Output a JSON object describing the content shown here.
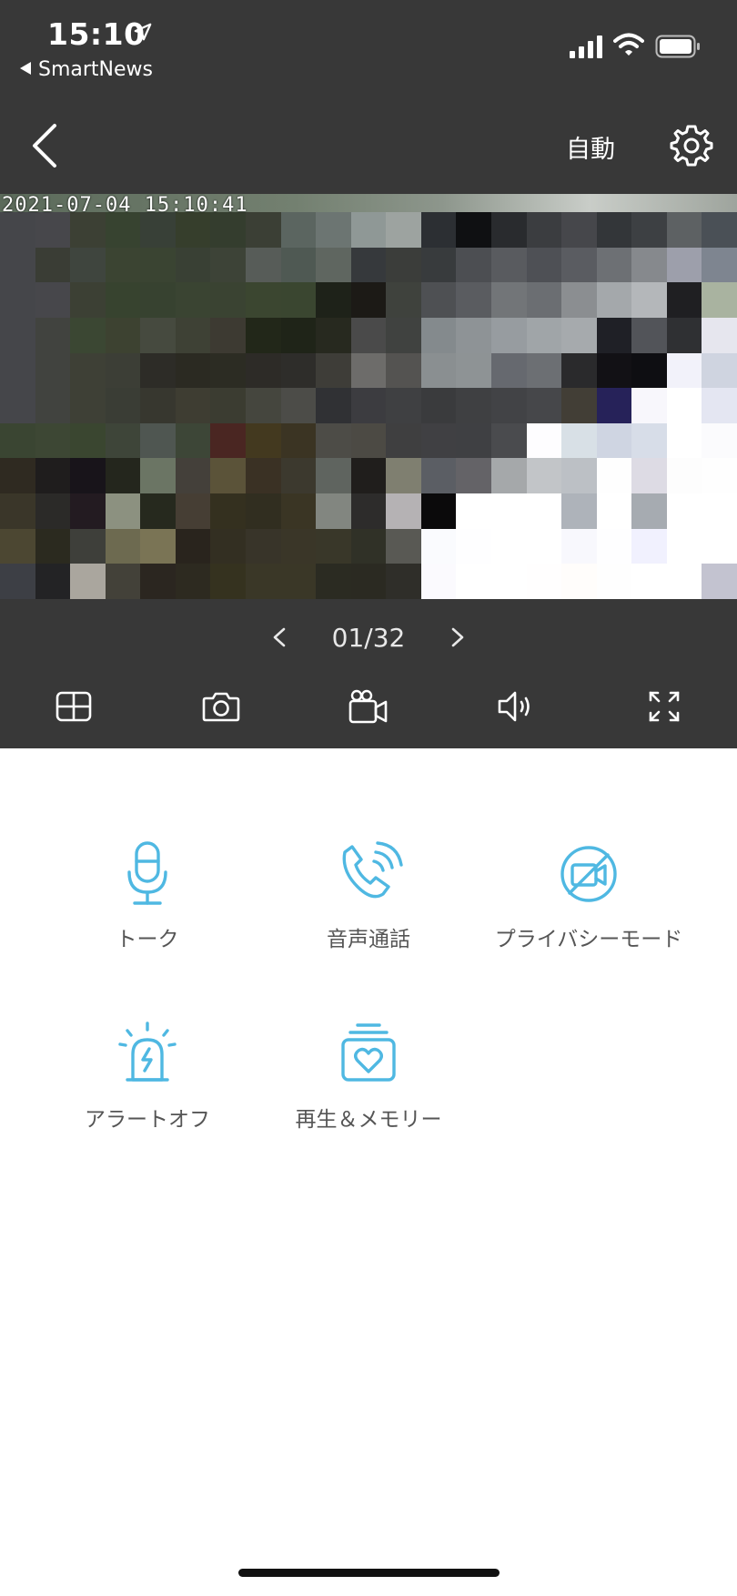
{
  "status_bar": {
    "time": "15:10",
    "back_app": "SmartNews",
    "icons": [
      "location-arrow-icon",
      "signal-icon",
      "wifi-icon",
      "battery-icon"
    ]
  },
  "nav": {
    "mode_label": "自動",
    "icons": [
      "back-chevron-icon",
      "gear-icon"
    ]
  },
  "video": {
    "timestamp": "2021-07-04  15:10:41",
    "mosaic_colors": [
      [
        "#45464a",
        "#47474b",
        "#3c4034",
        "#374330",
        "#384037",
        "#363e2c",
        "#343d2e",
        "#3b3f35",
        "#5b6560",
        "#6c7572",
        "#8f9896",
        "#9da3a0",
        "#2c2f33",
        "#0f1012",
        "#292b2e",
        "#3b3d40",
        "#46474b",
        "#333639",
        "#3d4043",
        "#5d6163",
        "#4a5056"
      ],
      [
        "#45464a",
        "#3a3d35",
        "#3f453e",
        "#3b4432",
        "#3a4432",
        "#394034",
        "#3d4337",
        "#575c58",
        "#4f5953",
        "#5f6660",
        "#36393c",
        "#3b3d3a",
        "#383b3d",
        "#4c4e52",
        "#595b5f",
        "#4e5055",
        "#5a5c61",
        "#6d7074",
        "#86898d",
        "#9d9fab",
        "#7e8590"
      ],
      [
        "#45464a",
        "#47474b",
        "#3c4034",
        "#37432f",
        "#374230",
        "#3a4432",
        "#3a4332",
        "#3b4630",
        "#3a4630",
        "#1e2219",
        "#1c1a16",
        "#3f423d",
        "#4e5053",
        "#5a5c60",
        "#727578",
        "#6b6e72",
        "#8b8e91",
        "#a4a8ab",
        "#b4b7ba",
        "#1f1f22",
        "#a9b3a0"
      ],
      [
        "#45464a",
        "#41433f",
        "#3b4733",
        "#3d4231",
        "#464a3f",
        "#3e4135",
        "#3d3a32",
        "#222719",
        "#1f2418",
        "#27291f",
        "#4a4a4a",
        "#404240",
        "#848a8d",
        "#8e9396",
        "#979ca0",
        "#a0a5a8",
        "#a6aaad",
        "#1f2026",
        "#525459",
        "#2f3033",
        "#e6e6ee"
      ],
      [
        "#45464a",
        "#41433f",
        "#3e4036",
        "#3c3e36",
        "#2d2c27",
        "#2b2a22",
        "#2c2c23",
        "#2d2b27",
        "#2e2d2a",
        "#3e3d38",
        "#6d6c6a",
        "#545351",
        "#8a8f91",
        "#8e9395",
        "#66696f",
        "#6c6f73",
        "#2a2a2c",
        "#121115",
        "#0e0e12",
        "#f2f2fa",
        "#cfd4e0"
      ],
      [
        "#45464a",
        "#41433f",
        "#3e4036",
        "#3a3d35",
        "#37372f",
        "#3e3d32",
        "#3b3c31",
        "#45463e",
        "#4c4c48",
        "#303134",
        "#3c3c40",
        "#3f4042",
        "#3a3b3d",
        "#3f4042",
        "#424346",
        "#46474a",
        "#423e36",
        "#262259",
        "#f8f7fc",
        "#ffffff",
        "#e4e6f2"
      ],
      [
        "#3a4532",
        "#3d4734",
        "#3a4630",
        "#3e4539",
        "#4f5651",
        "#3d4637",
        "#4a2622",
        "#43391f",
        "#3b3423",
        "#4d4c47",
        "#4c4a44",
        "#3f3f40",
        "#404043",
        "#3f4043",
        "#4a4b4e",
        "#fefdff",
        "#d8e0e6",
        "#cfd5e2",
        "#d7dde8",
        "#ffffff",
        "#fbfbfd"
      ],
      [
        "#2f2a21",
        "#1f1d1d",
        "#18141a",
        "#24261d",
        "#6b7564",
        "#44403a",
        "#5b5339",
        "#3a3124",
        "#3c392e",
        "#5f645f",
        "#201e1c",
        "#7f7f70",
        "#5b5e64",
        "#646367",
        "#a5a8aa",
        "#c2c5c8",
        "#bcc0c5",
        "#fefefe",
        "#dddbe4",
        "#fdfdfd",
        "#fefefe"
      ],
      [
        "#3a3629",
        "#2b2a28",
        "#231b21",
        "#8c9180",
        "#26291e",
        "#463e34",
        "#34301f",
        "#312e20",
        "#3a3524",
        "#828680",
        "#2d2c2b",
        "#b5b2b4",
        "#0b0a0b",
        "#ffffff",
        "#ffffff",
        "#ffffff",
        "#aeb3ba",
        "#ffffff",
        "#a6abb1",
        "#ffffff",
        "#ffffff"
      ],
      [
        "#4c4732",
        "#2b2a1f",
        "#3e3f3a",
        "#6d6a50",
        "#7a7455",
        "#29241d",
        "#332f22",
        "#383429",
        "#3a3628",
        "#393729",
        "#303127",
        "#595954",
        "#fafbfe",
        "#fefeff",
        "#ffffff",
        "#ffffff",
        "#f8f8fd",
        "#fefeff",
        "#f1f1fe",
        "#ffffff",
        "#ffffff"
      ],
      [
        "#3d3f45",
        "#232325",
        "#aaa69e",
        "#434139",
        "#2b2620",
        "#2d2a20",
        "#35321f",
        "#3a3727",
        "#3a3727",
        "#2b2b22",
        "#2b2a22",
        "#2f2e29",
        "#fbfafe",
        "#ffffff",
        "#ffffff",
        "#fffefe",
        "#fffdfb",
        "#fefefe",
        "#ffffff",
        "#ffffff",
        "#c3c3d0"
      ]
    ]
  },
  "pager": {
    "current": "01/32"
  },
  "toolbar": {
    "icons": [
      "split-view-icon",
      "camera-icon",
      "video-record-icon",
      "speaker-icon",
      "fullscreen-icon"
    ]
  },
  "actions": [
    {
      "label": "トーク",
      "icon": "microphone-icon"
    },
    {
      "label": "音声通話",
      "icon": "phone-call-icon"
    },
    {
      "label": "プライバシーモード",
      "icon": "privacy-mode-icon"
    },
    {
      "label": "アラートオフ",
      "icon": "alarm-light-icon"
    },
    {
      "label": "再生＆メモリー",
      "icon": "memory-album-icon"
    }
  ],
  "colors": {
    "header_bg": "#383838",
    "accent": "#4fb8e2",
    "label_text": "#555555"
  }
}
